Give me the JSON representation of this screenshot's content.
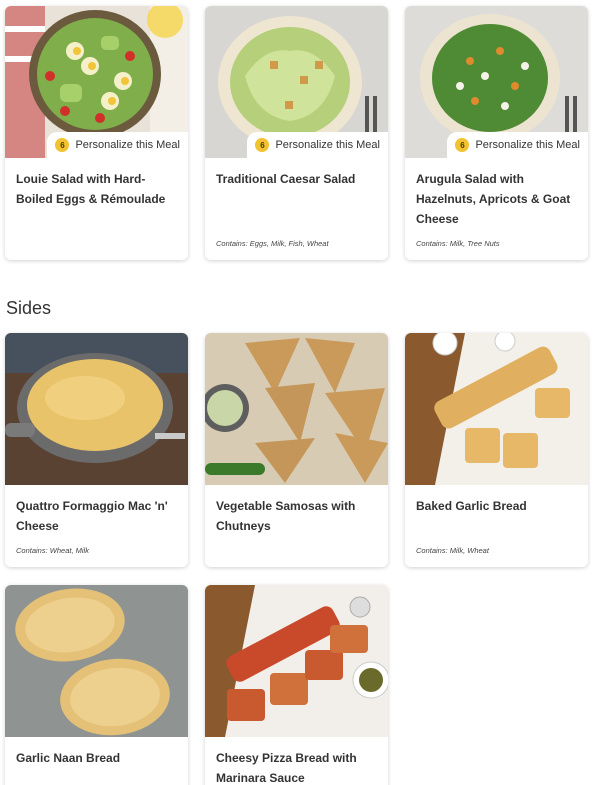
{
  "colors": {
    "badge": "#f2c230",
    "card_bg": "#ffffff",
    "page_bg": "#ffffff"
  },
  "salads": [
    {
      "title": "Louie Salad with Hard-Boiled Eggs & Rémoulade",
      "personalize_count": "6",
      "personalize_label": "Personalize this Meal",
      "contains": ""
    },
    {
      "title": "Traditional Caesar Salad",
      "personalize_count": "6",
      "personalize_label": "Personalize this Meal",
      "contains": "Contains: Eggs, Milk, Fish, Wheat"
    },
    {
      "title": "Arugula Salad with Hazelnuts, Apricots & Goat Cheese",
      "personalize_count": "6",
      "personalize_label": "Personalize this Meal",
      "contains": "Contains: Milk, Tree Nuts"
    }
  ],
  "sides_section": {
    "title": "Sides"
  },
  "sides": [
    {
      "title": "Quattro Formaggio Mac 'n' Cheese",
      "contains": "Contains: Wheat, Milk"
    },
    {
      "title": "Vegetable Samosas with Chutneys",
      "contains": ""
    },
    {
      "title": "Baked Garlic Bread",
      "contains": "Contains: Milk, Wheat"
    },
    {
      "title": "Garlic Naan Bread",
      "contains": ""
    },
    {
      "title": "Cheesy Pizza Bread with Marinara Sauce",
      "contains": ""
    }
  ]
}
